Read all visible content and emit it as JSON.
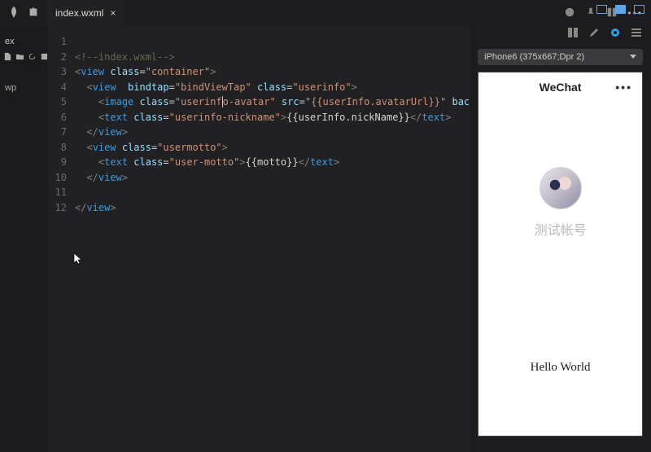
{
  "tab": {
    "filename": "index.wxml"
  },
  "sidebar": {
    "file": "ex",
    "label": "wp"
  },
  "device": {
    "selected": "iPhone6 (375x667;Dpr 2)"
  },
  "code": {
    "lines": [
      {
        "n": 1,
        "raw": "<!--index.wxml-->"
      },
      {
        "n": 2,
        "raw": "<view class=\"container\">"
      },
      {
        "n": 3,
        "raw": "  <view  bindtap=\"bindViewTap\" class=\"userinfo\">"
      },
      {
        "n": 4,
        "raw": "    <image class=\"userinfo-avatar\" src=\"{{userInfo.avatarUrl}}\" bac"
      },
      {
        "n": 5,
        "raw": "    <text class=\"userinfo-nickname\">{{userInfo.nickName}}</text>"
      },
      {
        "n": 6,
        "raw": "  </view>"
      },
      {
        "n": 7,
        "raw": "  <view class=\"usermotto\">"
      },
      {
        "n": 8,
        "raw": "    <text class=\"user-motto\">{{motto}}</text>"
      },
      {
        "n": 9,
        "raw": "  </view>"
      },
      {
        "n": 10,
        "raw": ""
      },
      {
        "n": 11,
        "raw": "</view>"
      },
      {
        "n": 12,
        "raw": ""
      }
    ]
  },
  "preview": {
    "navTitle": "WeChat",
    "nickname": "测试帐号",
    "motto": "Hello World"
  }
}
